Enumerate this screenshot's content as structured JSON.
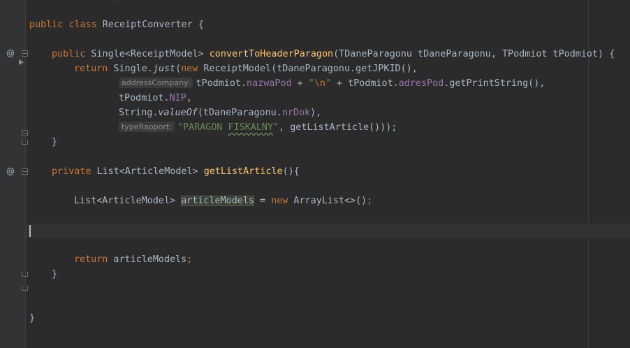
{
  "editor": {
    "lines": {
      "class_decl": {
        "kw": "public class",
        "name": " ReceiptConverter {"
      },
      "method1": {
        "kw": "public",
        "ret": " Single<ReceiptModel> ",
        "name": "convertToHeaderParagon",
        "params": "(TDaneParagonu tDaneParagonu, TPodmiot tPodmiot) {"
      },
      "ret1": {
        "kw": "return",
        "pre": " Single.",
        "just": "just",
        "mid": "(",
        "new_kw": "new",
        "rest": " ReceiptModel(tDaneParagonu.getJPKID(),"
      },
      "arg_address": {
        "hint": "addressCompany:",
        "a": "tPodmiot.",
        "field1": "nazwaPod",
        "b": " + ",
        "str_open": "\"",
        "escape": "\\n",
        "str_close": "\"",
        "c": " + tPodmiot.",
        "field2": "adresPod",
        "d": ".getPrintString(),"
      },
      "arg_nip": {
        "a": "tPodmiot.",
        "field": "NIP",
        "b": ","
      },
      "arg_nrdok": {
        "a": "String.",
        "valueof": "valueOf",
        "b": "(tDaneParagonu.",
        "field": "nrDok",
        "c": "),"
      },
      "arg_type": {
        "hint": "typeRapport:",
        "str_a": "\"PARAGON ",
        "str_typo": "FISKALNY",
        "str_b": "\"",
        "rest": ", getListArticle()));"
      },
      "close1": "}",
      "method2": {
        "kw": "private",
        "ret": " List<ArticleModel> ",
        "name": "getListArticle",
        "params": "(){"
      },
      "list_decl": {
        "type": "List<ArticleModel> ",
        "var": "articleModels",
        "eq": " = ",
        "new_kw": "new",
        "rest": " ArrayList<>()",
        "semi": ";"
      },
      "ret2": {
        "kw": "return",
        "var": " articleModels",
        "semi": ";"
      },
      "close2": "}",
      "close_class": "}"
    },
    "gutter": {
      "override_marker": "@"
    },
    "colors": {
      "background": "#2b2b2b",
      "keyword": "#cc7832",
      "method": "#ffc66d",
      "field": "#9876aa",
      "string": "#6a8759",
      "text": "#a9b7c6"
    }
  }
}
